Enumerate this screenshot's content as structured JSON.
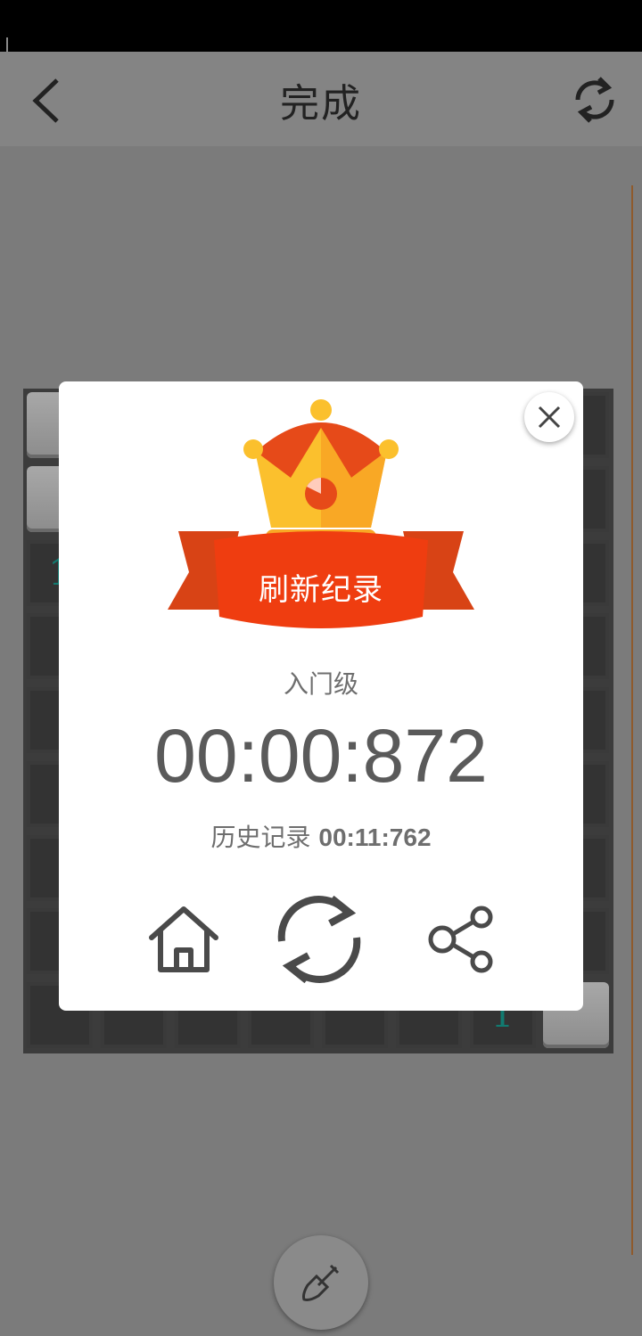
{
  "header": {
    "title": "完成"
  },
  "board": {
    "visible_numbers": [
      {
        "row": 2,
        "col": 0,
        "value": "1"
      },
      {
        "row": 8,
        "col": 6,
        "value": "1"
      }
    ]
  },
  "dialog": {
    "banner_text": "刷新纪录",
    "level": "入门级",
    "time": "00:00:872",
    "history_label": "历史记录",
    "history_value": "00:11:762"
  },
  "colors": {
    "crown_gold": "#fbc02d",
    "crown_red": "#e64a19",
    "ribbon": "#e64a19",
    "number_teal": "#117a70"
  },
  "icons": {
    "back": "chevron-left",
    "refresh": "refresh",
    "close": "close",
    "home": "home",
    "restart": "refresh",
    "share": "share",
    "dig": "shovel"
  }
}
